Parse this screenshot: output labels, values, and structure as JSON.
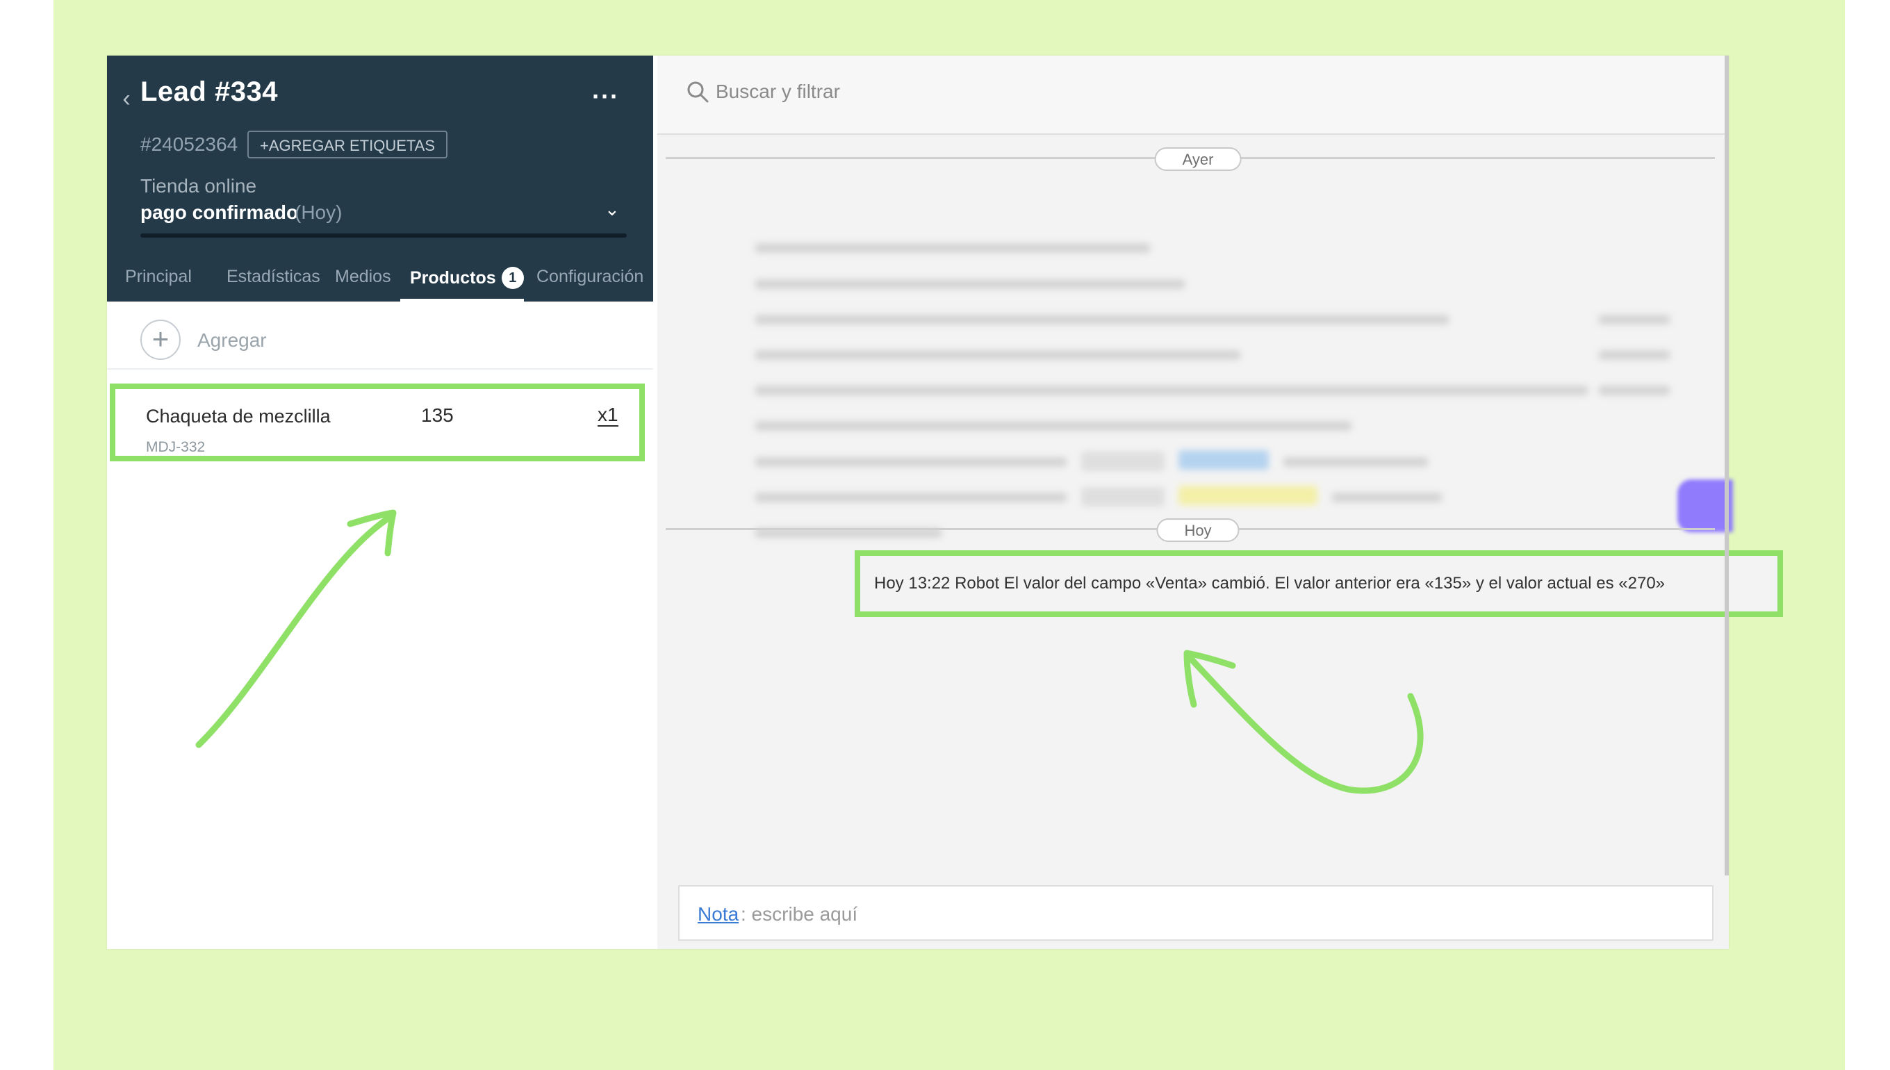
{
  "lead": {
    "title": "Lead #334",
    "id": "#24052364",
    "tags_button": "+AGREGAR ETIQUETAS",
    "pipeline": "Tienda online",
    "stage": "pago confirmado",
    "stage_when": "(Hoy)"
  },
  "tabs": [
    {
      "label": "Principal"
    },
    {
      "label": "Estadísticas"
    },
    {
      "label": "Medios"
    },
    {
      "label": "Productos",
      "badge": "1",
      "active": true
    },
    {
      "label": "Configuración"
    }
  ],
  "products": {
    "add_label": "Agregar",
    "items": [
      {
        "name": "Chaqueta de mezclilla",
        "price": "135",
        "qty": "x1",
        "sku": "MDJ-332"
      }
    ]
  },
  "feed": {
    "search_placeholder": "Buscar y filtrar",
    "day_yesterday": "Ayer",
    "day_today": "Hoy",
    "event_text": "Hoy 13:22 Robot El valor del campo «Venta» cambió. El valor anterior era «135» y el valor actual es «270»"
  },
  "note": {
    "label": "Nota",
    "placeholder": ": escribe aquí"
  },
  "colors": {
    "header_bg": "#253a48",
    "highlight_green": "#8fe066",
    "page_green": "#e2f8bc",
    "link_blue": "#3a7bd5"
  }
}
